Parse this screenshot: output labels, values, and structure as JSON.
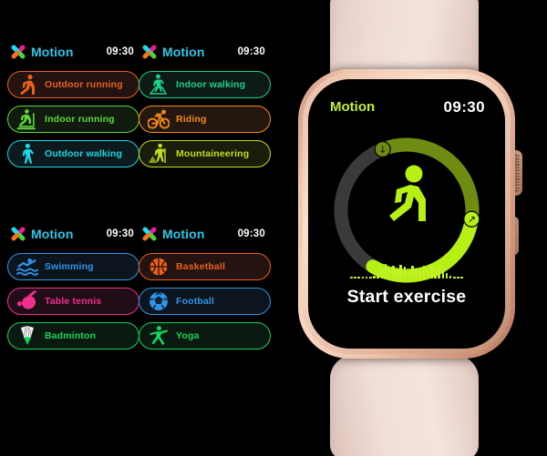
{
  "app": {
    "logo_icon": "motion-x-logo",
    "logo_colors": [
      "#f5179c",
      "#18e0ea",
      "#4fd33a",
      "#f37521"
    ],
    "title": "Motion",
    "time": "09:30",
    "title_color": "#2ec6e8"
  },
  "screens": [
    {
      "id": "screen-1",
      "header": {
        "title": "Motion",
        "time": "09:30"
      },
      "items": [
        {
          "label": "Outdoor running",
          "icon": "runner-icon",
          "color": "#e8601c",
          "fill": "#241310"
        },
        {
          "label": "Indoor running",
          "icon": "treadmill-icon",
          "color": "#5fd838",
          "fill": "#101a0e"
        },
        {
          "label": "Outdoor walking",
          "icon": "walking-person-icon",
          "color": "#18d8e8",
          "fill": "#0d1a1d"
        }
      ]
    },
    {
      "id": "screen-2",
      "header": {
        "title": "Motion",
        "time": "09:30"
      },
      "items": [
        {
          "label": "Indoor walking",
          "icon": "walking-machine-icon",
          "color": "#1fd18a",
          "fill": "#0d1a16"
        },
        {
          "label": "Riding",
          "icon": "bicycle-icon",
          "color": "#f58a18",
          "fill": "#241710"
        },
        {
          "label": "Mountaineering",
          "icon": "hiker-icon",
          "color": "#bde118",
          "fill": "#1b1c0c"
        }
      ]
    },
    {
      "id": "screen-3",
      "header": {
        "title": "Motion",
        "time": "09:30"
      },
      "items": [
        {
          "label": "Swimming",
          "icon": "swimmer-icon",
          "color": "#2f95e8",
          "fill": "#0c141d"
        },
        {
          "label": "Table tennis",
          "icon": "ping-pong-paddle-icon",
          "color": "#f0308c",
          "fill": "#200d18"
        },
        {
          "label": "Badminton",
          "icon": "shuttlecock-icon",
          "color": "#15d460",
          "fill": "#0b1a10"
        }
      ]
    },
    {
      "id": "screen-4",
      "header": {
        "title": "Motion",
        "time": "09:30"
      },
      "items": [
        {
          "label": "Basketball",
          "icon": "basketball-icon",
          "color": "#e8601c",
          "fill": "#241310"
        },
        {
          "label": "Football",
          "icon": "soccer-ball-icon",
          "color": "#2f95e8",
          "fill": "#0c141d"
        },
        {
          "label": "Yoga",
          "icon": "yoga-pose-icon",
          "color": "#15d460",
          "fill": "#0b1a10"
        }
      ]
    }
  ],
  "watch": {
    "case_color": "#edc3a9",
    "band_color": "#f0ddd6",
    "header": {
      "title": "Motion",
      "time": "09:30",
      "title_color": "#c4f028"
    },
    "center_icon": "running-person-icon",
    "cta_label": "Start exercise",
    "ring": {
      "progress_color": "#b6f014",
      "secondary_color": "#6f8c12",
      "track_color": "#3a3a3a",
      "progress_percent": 38,
      "secondary_percent": 40,
      "start_marker_icon": "arrow-up-right-icon",
      "end_marker_icon": "arrow-down-icon"
    },
    "waveform": {
      "color": "#c4f028",
      "bars": [
        2,
        2,
        2,
        2,
        2,
        2,
        3,
        5,
        9,
        16,
        11,
        14,
        10,
        15,
        13,
        9,
        14,
        11,
        8,
        14,
        12,
        15,
        9,
        13,
        10,
        6,
        3,
        2,
        2,
        2
      ]
    }
  }
}
